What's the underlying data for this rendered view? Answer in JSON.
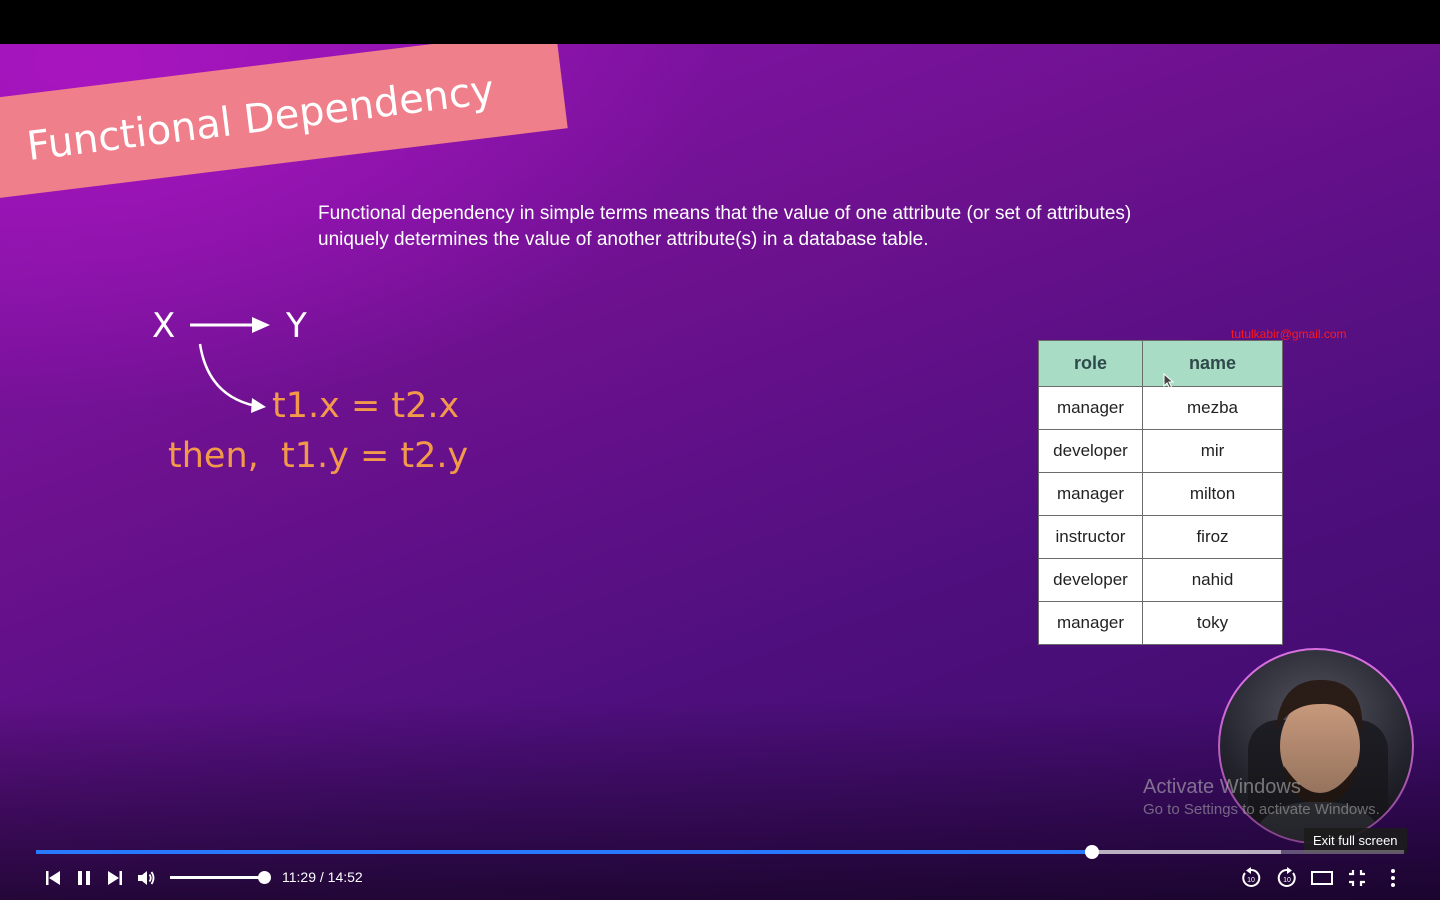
{
  "slide": {
    "title": "Functional Dependency",
    "definition": "Functional dependency in simple terms means that the value of one attribute (or set of attributes) uniquely determines the value of another attribute(s) in a database table.",
    "notation_x": "X",
    "notation_y": "Y",
    "equation_1": "t1.x = t2.x",
    "equation_2": "then,  t1.y = t2.y",
    "email": "tutulkabir@gmail.com",
    "table": {
      "headers": [
        "role",
        "name"
      ],
      "rows": [
        [
          "manager",
          "mezba"
        ],
        [
          "developer",
          "mir"
        ],
        [
          "manager",
          "milton"
        ],
        [
          "instructor",
          "firoz"
        ],
        [
          "developer",
          "nahid"
        ],
        [
          "manager",
          "toky"
        ]
      ]
    }
  },
  "overlay": {
    "activate_title": "Activate Windows",
    "activate_sub": "Go to Settings to activate Windows.",
    "tooltip": "Exit full screen"
  },
  "player": {
    "time_display": "11:29 / 14:52",
    "progress_fraction": 0.772,
    "buffer_fraction": 0.91,
    "volume_fraction": 1.0,
    "accent_color": "#2979ff",
    "icons": [
      "previous-icon",
      "pause-icon",
      "next-icon",
      "volume-icon",
      "rewind-10-icon",
      "forward-10-icon",
      "theater-mode-icon",
      "exit-fullscreen-icon",
      "more-options-icon"
    ]
  }
}
